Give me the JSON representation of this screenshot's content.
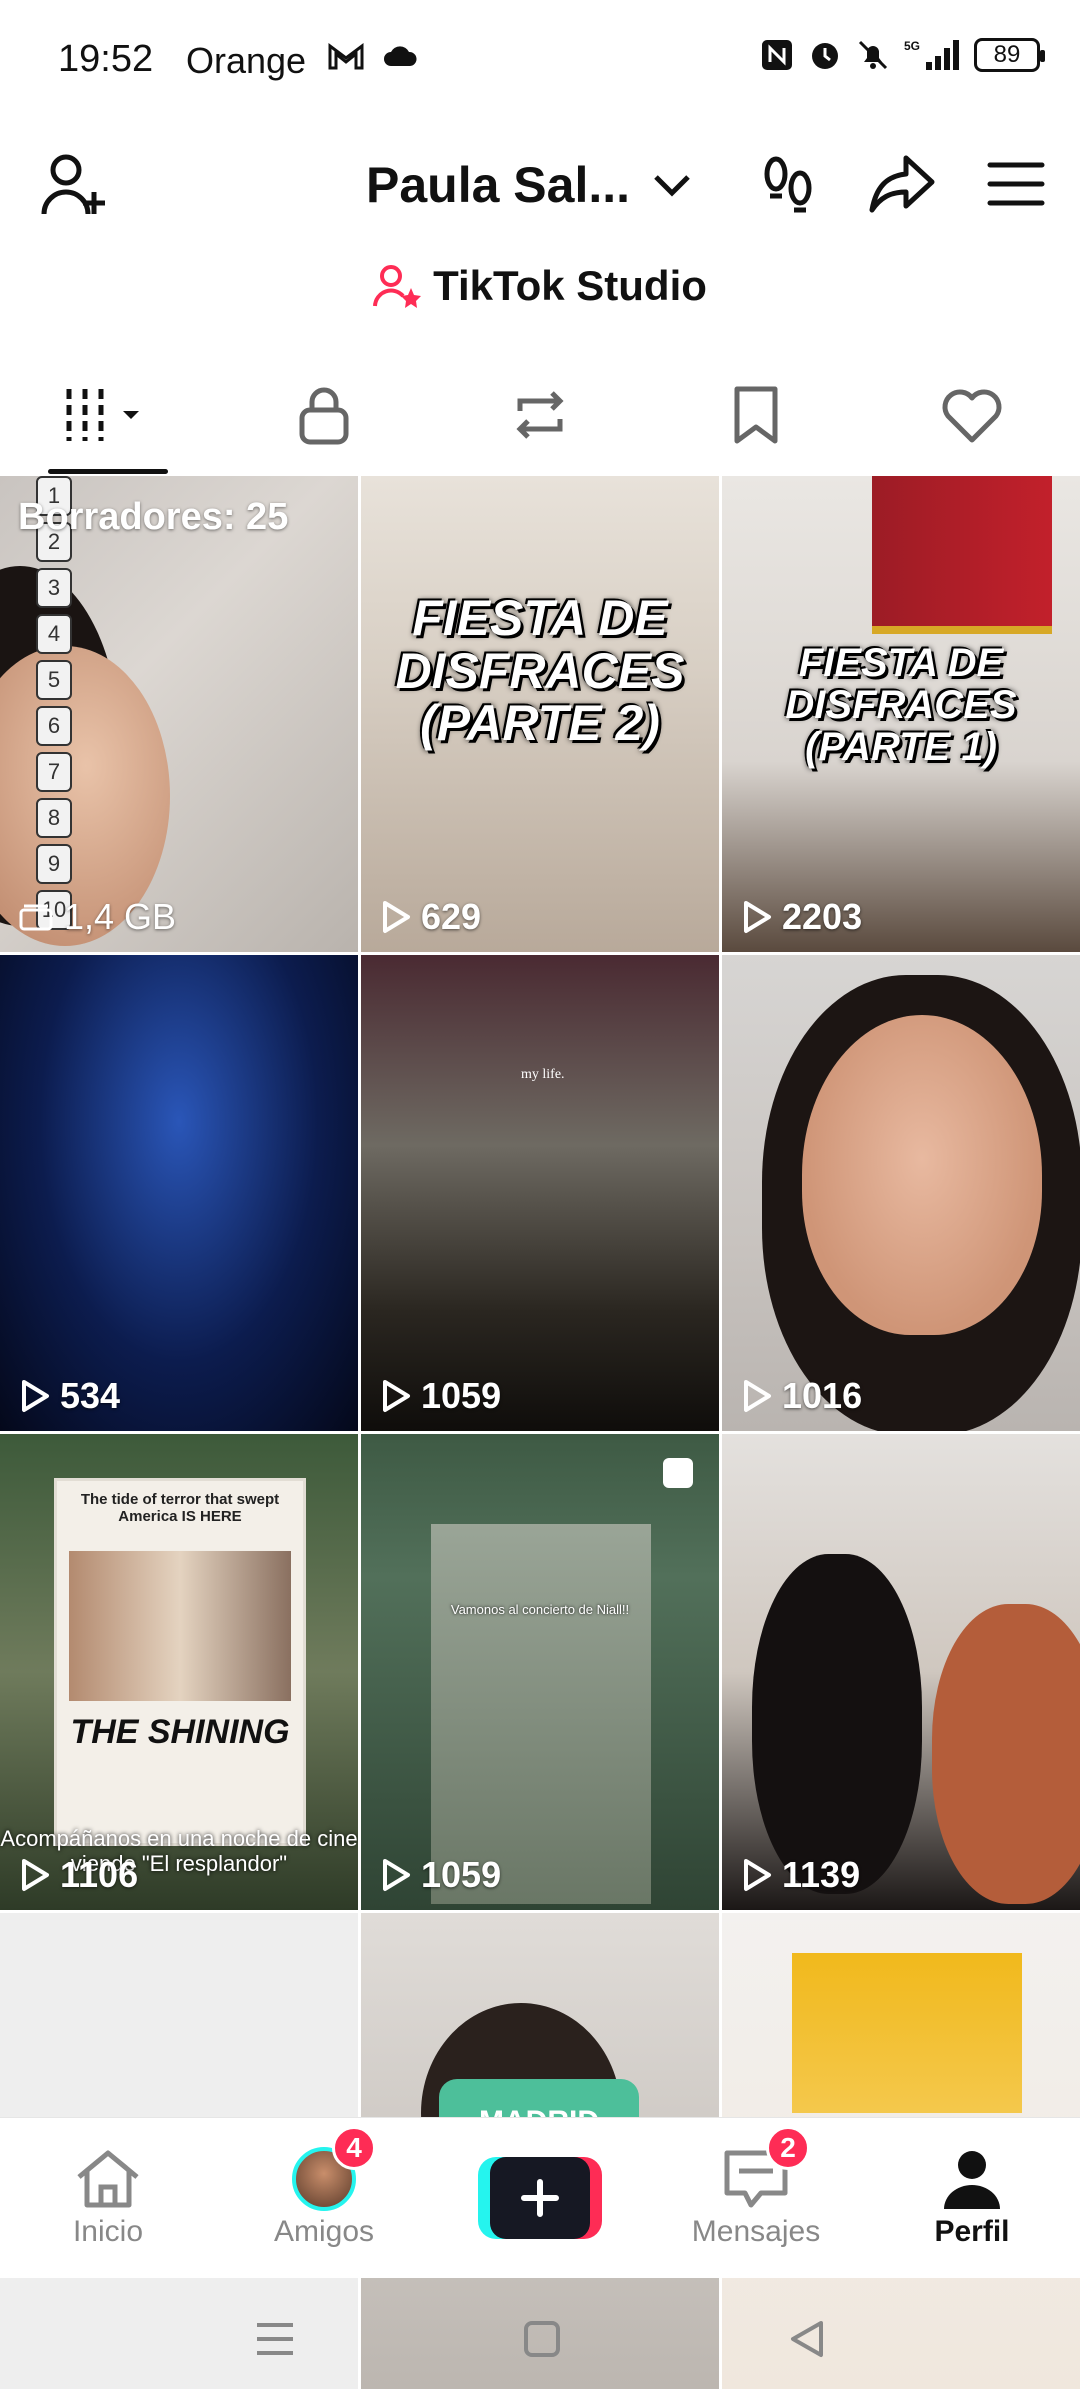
{
  "status_bar": {
    "time": "19:52",
    "carrier": "Orange",
    "battery": "89",
    "network": "5G"
  },
  "header": {
    "profile_name": "Paula Sal...",
    "studio_label": "TikTok Studio"
  },
  "tabs": [
    {
      "name": "videos",
      "icon": "grid-icon",
      "active": true
    },
    {
      "name": "private",
      "icon": "lock-icon",
      "active": false
    },
    {
      "name": "reposts",
      "icon": "repost-icon",
      "active": false
    },
    {
      "name": "favorites",
      "icon": "bookmark-icon",
      "active": false
    },
    {
      "name": "liked",
      "icon": "heart-icon",
      "active": false
    }
  ],
  "drafts": {
    "label": "Borradores: 25",
    "size": "1,4 GB",
    "numbers": [
      "1",
      "2",
      "3",
      "4",
      "5",
      "6",
      "7",
      "8",
      "9",
      "10"
    ]
  },
  "videos": [
    {
      "views": "629",
      "title": "FIESTA DE DISFRACES (PARTE 2)"
    },
    {
      "views": "2203",
      "title": "FIESTA DE DISFRACES (PARTE 1)"
    },
    {
      "views": "534"
    },
    {
      "views": "1059",
      "caption": "my life."
    },
    {
      "views": "1016"
    },
    {
      "views": "1106",
      "poster_head": "The tide of terror that swept America IS HERE",
      "poster_title": "THE SHINING",
      "caption": "Acompáñanos en una noche de cine viendo \"El resplandor\""
    },
    {
      "views": "1059",
      "caption": "Vamonos al concierto de Niall!!"
    },
    {
      "views": "1139"
    },
    {
      "views": ""
    },
    {
      "views": "",
      "caption": "MADRID"
    },
    {
      "views": ""
    }
  ],
  "bottom_nav": {
    "home": "Inicio",
    "friends": "Amigos",
    "friends_badge": "4",
    "messages": "Mensajes",
    "messages_badge": "2",
    "profile": "Perfil"
  },
  "colors": {
    "accent_red": "#fe2c55",
    "accent_cyan": "#25f4ee"
  }
}
